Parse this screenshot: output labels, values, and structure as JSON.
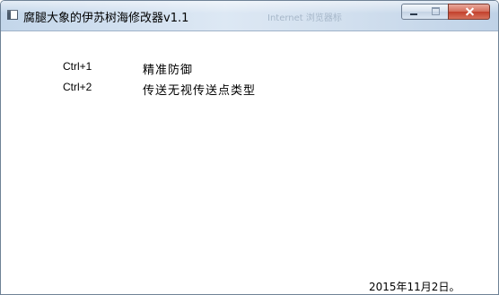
{
  "window": {
    "title": "腐腿大象的伊苏树海修改器v1.1",
    "background_title": "Internet 浏览器标",
    "icon": "app-window-icon"
  },
  "hotkeys": [
    {
      "key": "Ctrl+1",
      "action": "精准防御"
    },
    {
      "key": "Ctrl+2",
      "action": "传送无视传送点类型"
    }
  ],
  "footer": {
    "date": "2015年11月2日。"
  }
}
